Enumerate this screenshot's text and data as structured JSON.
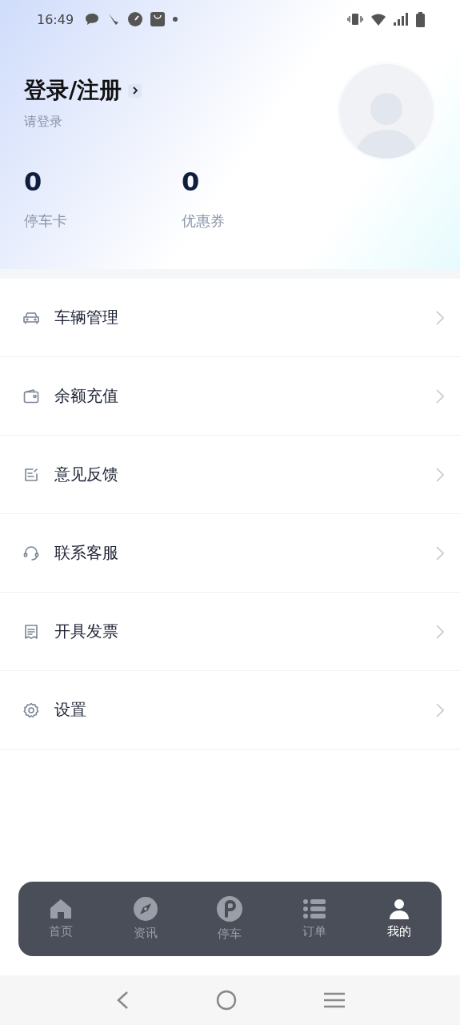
{
  "status_bar": {
    "time": "16:49"
  },
  "profile": {
    "title": "登录/注册",
    "subtitle": "请登录"
  },
  "stats": [
    {
      "value": "0",
      "label": "停车卡"
    },
    {
      "value": "0",
      "label": "优惠券"
    }
  ],
  "menu": [
    {
      "kind": "car",
      "label": "车辆管理"
    },
    {
      "kind": "wallet",
      "label": "余额充值"
    },
    {
      "kind": "feedback",
      "label": "意见反馈"
    },
    {
      "kind": "headset",
      "label": "联系客服"
    },
    {
      "kind": "invoice",
      "label": "开具发票"
    },
    {
      "kind": "settings",
      "label": "设置"
    }
  ],
  "tabs": [
    {
      "kind": "home",
      "label": "首页",
      "selected": false
    },
    {
      "kind": "compass",
      "label": "资讯",
      "selected": false
    },
    {
      "kind": "parking",
      "label": "停车",
      "selected": false
    },
    {
      "kind": "list",
      "label": "订单",
      "selected": false
    },
    {
      "kind": "user",
      "label": "我的",
      "selected": true
    }
  ]
}
